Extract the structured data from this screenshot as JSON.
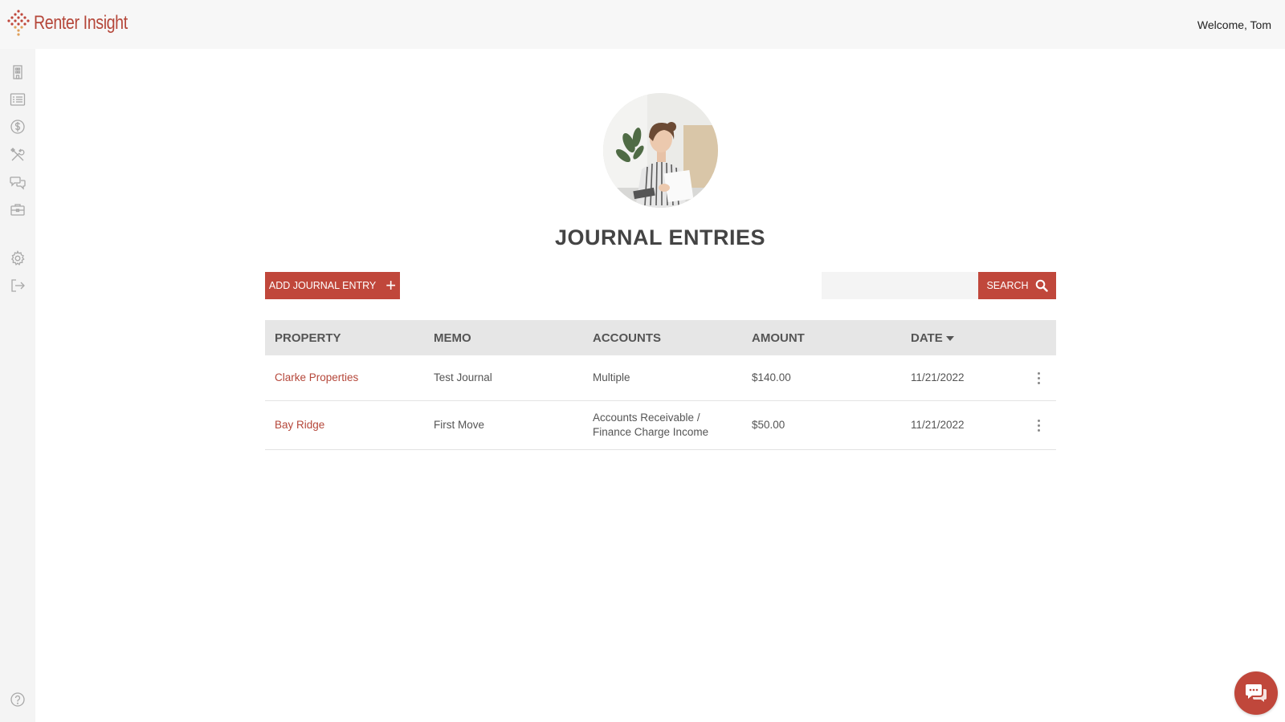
{
  "app": {
    "name": "Renter Insight",
    "welcome": "Welcome, Tom",
    "brand_color": "#c0473b"
  },
  "sidebar": {
    "items": [
      {
        "icon": "building-icon"
      },
      {
        "icon": "list-icon"
      },
      {
        "icon": "dollar-icon"
      },
      {
        "icon": "tools-icon"
      },
      {
        "icon": "chat-bubbles-icon"
      },
      {
        "icon": "briefcase-icon"
      },
      {
        "icon": "gear-icon"
      },
      {
        "icon": "logout-icon"
      },
      {
        "icon": "help-icon"
      }
    ]
  },
  "page": {
    "title": "JOURNAL ENTRIES",
    "add_button": "ADD JOURNAL ENTRY",
    "search": {
      "value": "",
      "placeholder": "",
      "button": "SEARCH"
    }
  },
  "table": {
    "columns": [
      "PROPERTY",
      "MEMO",
      "ACCOUNTS",
      "AMOUNT",
      "DATE"
    ],
    "sort_column": "DATE",
    "sort_direction": "descending",
    "rows": [
      {
        "property": "Clarke Properties",
        "memo": "Test Journal",
        "accounts_line1": "Multiple",
        "accounts_line2": "",
        "amount": "$140.00",
        "date": "11/21/2022"
      },
      {
        "property": "Bay Ridge",
        "memo": "First Move",
        "accounts_line1": "Accounts Receivable /",
        "accounts_line2": "Finance Charge Income",
        "amount": "$50.00",
        "date": "11/21/2022"
      }
    ]
  }
}
